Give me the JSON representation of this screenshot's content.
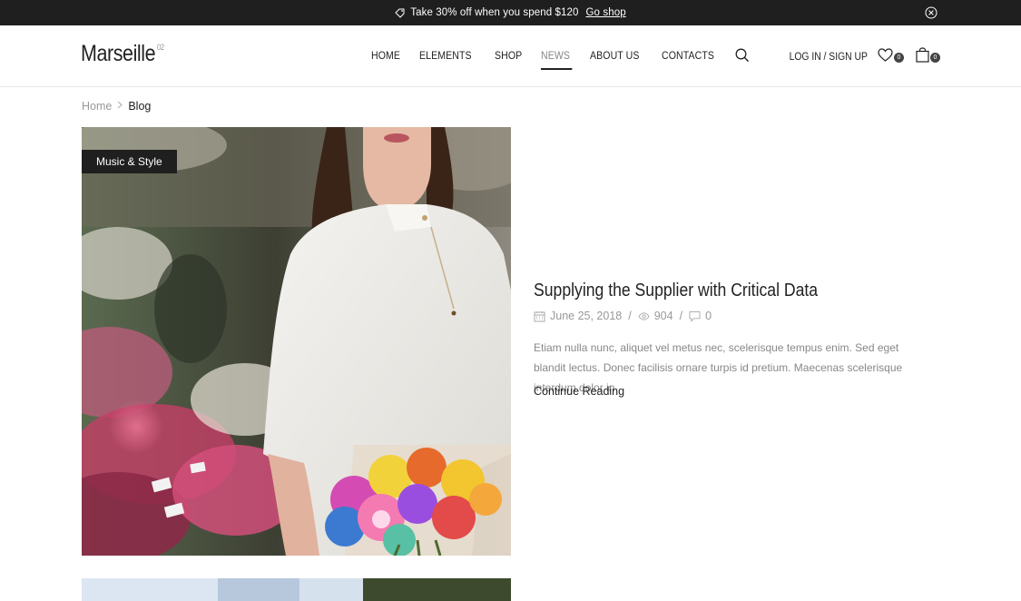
{
  "promo": {
    "text": "Take 30% off when you spend $120",
    "link": "Go shop",
    "icons": {
      "tag": "tag-icon",
      "close": "close-circle-icon"
    }
  },
  "header": {
    "logo": "Marseille",
    "logo_sup": "02",
    "nav": [
      {
        "label": "HOME",
        "active": false
      },
      {
        "label": "ELEMENTS",
        "active": false
      },
      {
        "label": "SHOP",
        "active": false
      },
      {
        "label": "NEWS",
        "active": true
      },
      {
        "label": "ABOUT US",
        "active": false
      },
      {
        "label": "CONTACTS",
        "active": false
      }
    ],
    "login": "LOG IN / SIGN UP",
    "wishlist_count": "0",
    "cart_count": "0"
  },
  "breadcrumb": {
    "home": "Home",
    "current": "Blog"
  },
  "post": {
    "category": "Music & Style",
    "title": "Supplying the Supplier with Critical Data",
    "date": "June 25, 2018",
    "views": "904",
    "comments": "0",
    "excerpt": "Etiam nulla nunc, aliquet vel metus nec, scelerisque tempus enim. Sed eget blandit lectus. Donec facilisis ornare turpis id pretium. Maecenas scelerisque interdum dolor in",
    "continue": "Continue Reading"
  },
  "colors": {
    "dark": "#1f1f1f",
    "text": "#222222",
    "muted": "#999999",
    "border": "#e8e8e8"
  }
}
